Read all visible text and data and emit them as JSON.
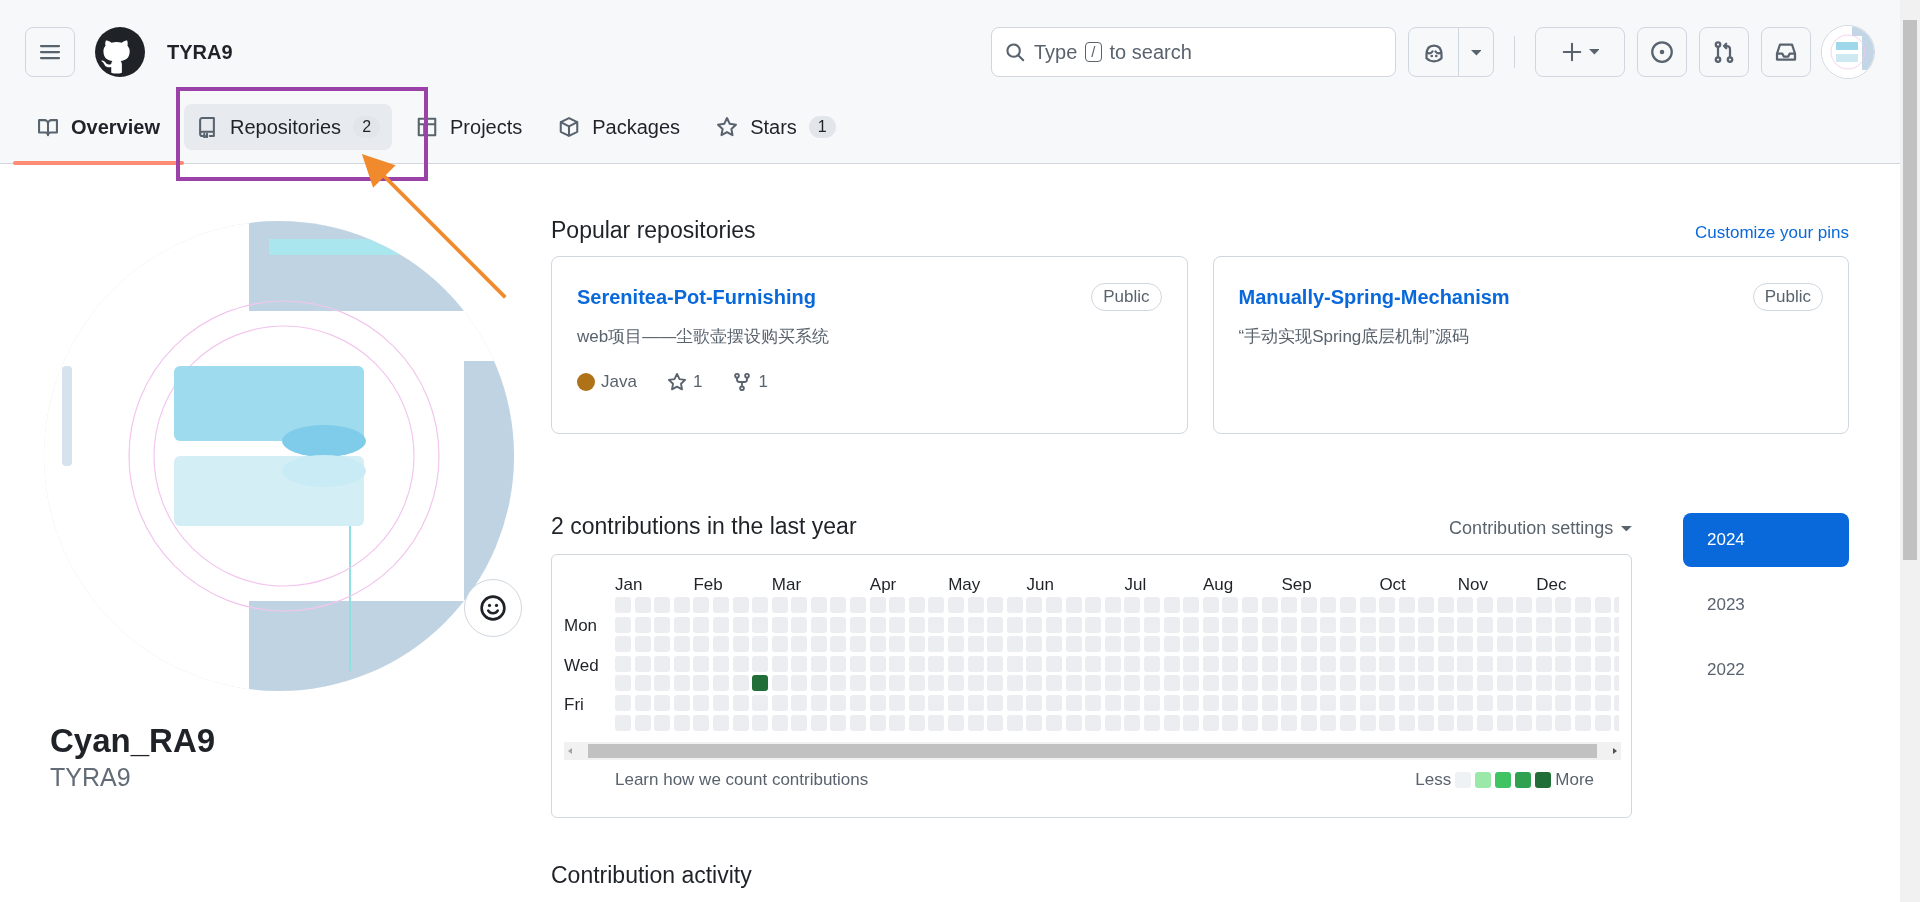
{
  "header": {
    "username": "TYRA9",
    "search": {
      "before": "Type",
      "key": "/",
      "after": "to search"
    }
  },
  "tabs": [
    {
      "label": "Overview",
      "selected": true,
      "hovered": false
    },
    {
      "label": "Repositories",
      "count": "2",
      "selected": false,
      "hovered": true
    },
    {
      "label": "Projects",
      "selected": false,
      "hovered": false
    },
    {
      "label": "Packages",
      "selected": false,
      "hovered": false
    },
    {
      "label": "Stars",
      "count": "1",
      "selected": false,
      "hovered": false
    }
  ],
  "profile": {
    "name": "Cyan_RA9",
    "login": "TYRA9"
  },
  "popular": {
    "title": "Popular repositories",
    "action": "Customize your pins",
    "repos": [
      {
        "name": "Serenitea-Pot-Furnishing",
        "visibility": "Public",
        "description": "web项目——尘歌壶摆设购买系统",
        "language": {
          "name": "Java",
          "color": "#b07219"
        },
        "stargazers": "1",
        "forks": "1"
      },
      {
        "name": "Manually-Spring-Mechanism",
        "visibility": "Public",
        "description": "“手动实现Spring底层机制”源码"
      }
    ]
  },
  "contributions": {
    "title": "2 contributions in the last year",
    "settings": "Contribution settings",
    "months": [
      "Jan",
      "Feb",
      "Mar",
      "Apr",
      "May",
      "Jun",
      "Jul",
      "Aug",
      "Sep",
      "Oct",
      "Nov",
      "Dec"
    ],
    "weekdays": [
      "Mon",
      "Wed",
      "Fri"
    ],
    "weeks": [
      [
        {
          "color": "#ebedf0"
        },
        {
          "color": "#ebedf0"
        },
        {
          "color": "#ebedf0"
        },
        {
          "color": "#ebedf0"
        },
        {
          "color": "#ebedf0"
        },
        {
          "color": "#ebedf0"
        },
        {
          "color": "#ebedf0"
        }
      ],
      [
        {
          "color": "#ebedf0"
        },
        {
          "color": "#ebedf0"
        },
        {
          "color": "#ebedf0"
        },
        {
          "color": "#ebedf0"
        },
        {
          "color": "#ebedf0"
        },
        {
          "color": "#ebedf0"
        },
        {
          "color": "#ebedf0"
        }
      ],
      [
        {
          "color": "#ebedf0"
        },
        {
          "color": "#ebedf0"
        },
        {
          "color": "#ebedf0"
        },
        {
          "color": "#ebedf0"
        },
        {
          "color": "#ebedf0"
        },
        {
          "color": "#ebedf0"
        },
        {
          "color": "#ebedf0"
        }
      ],
      [
        {
          "color": "#ebedf0"
        },
        {
          "color": "#ebedf0"
        },
        {
          "color": "#ebedf0"
        },
        {
          "color": "#ebedf0"
        },
        {
          "color": "#ebedf0"
        },
        {
          "color": "#ebedf0"
        },
        {
          "color": "#ebedf0"
        }
      ],
      [
        {
          "color": "#ebedf0"
        },
        {
          "color": "#ebedf0"
        },
        {
          "color": "#ebedf0"
        },
        {
          "color": "#ebedf0"
        },
        {
          "color": "#ebedf0"
        },
        {
          "color": "#ebedf0"
        },
        {
          "color": "#ebedf0"
        }
      ],
      [
        {
          "color": "#ebedf0"
        },
        {
          "color": "#ebedf0"
        },
        {
          "color": "#ebedf0"
        },
        {
          "color": "#ebedf0"
        },
        {
          "color": "#ebedf0"
        },
        {
          "color": "#ebedf0"
        },
        {
          "color": "#ebedf0"
        }
      ],
      [
        {
          "color": "#ebedf0"
        },
        {
          "color": "#ebedf0"
        },
        {
          "color": "#ebedf0"
        },
        {
          "color": "#ebedf0"
        },
        {
          "color": "#ebedf0"
        },
        {
          "color": "#ebedf0"
        },
        {
          "color": "#ebedf0"
        }
      ],
      [
        {
          "color": "#ebedf0"
        },
        {
          "color": "#ebedf0"
        },
        {
          "color": "#ebedf0"
        },
        {
          "color": "#ebedf0"
        },
        {
          "color": "#216e39"
        },
        {
          "color": "#ebedf0"
        },
        {
          "color": "#ebedf0"
        }
      ],
      [
        {
          "color": "#ebedf0"
        },
        {
          "color": "#ebedf0"
        },
        {
          "color": "#ebedf0"
        },
        {
          "color": "#ebedf0"
        },
        {
          "color": "#ebedf0"
        },
        {
          "color": "#ebedf0"
        },
        {
          "color": "#ebedf0"
        }
      ],
      [
        {
          "color": "#ebedf0"
        },
        {
          "color": "#ebedf0"
        },
        {
          "color": "#ebedf0"
        },
        {
          "color": "#ebedf0"
        },
        {
          "color": "#ebedf0"
        },
        {
          "color": "#ebedf0"
        },
        {
          "color": "#ebedf0"
        }
      ],
      [
        {
          "color": "#ebedf0"
        },
        {
          "color": "#ebedf0"
        },
        {
          "color": "#ebedf0"
        },
        {
          "color": "#ebedf0"
        },
        {
          "color": "#ebedf0"
        },
        {
          "color": "#ebedf0"
        },
        {
          "color": "#ebedf0"
        }
      ],
      [
        {
          "color": "#ebedf0"
        },
        {
          "color": "#ebedf0"
        },
        {
          "color": "#ebedf0"
        },
        {
          "color": "#ebedf0"
        },
        {
          "color": "#ebedf0"
        },
        {
          "color": "#ebedf0"
        },
        {
          "color": "#ebedf0"
        }
      ],
      [
        {
          "color": "#ebedf0"
        },
        {
          "color": "#ebedf0"
        },
        {
          "color": "#ebedf0"
        },
        {
          "color": "#ebedf0"
        },
        {
          "color": "#ebedf0"
        },
        {
          "color": "#ebedf0"
        },
        {
          "color": "#ebedf0"
        }
      ],
      [
        {
          "color": "#ebedf0"
        },
        {
          "color": "#ebedf0"
        },
        {
          "color": "#ebedf0"
        },
        {
          "color": "#ebedf0"
        },
        {
          "color": "#ebedf0"
        },
        {
          "color": "#ebedf0"
        },
        {
          "color": "#ebedf0"
        }
      ],
      [
        {
          "color": "#ebedf0"
        },
        {
          "color": "#ebedf0"
        },
        {
          "color": "#ebedf0"
        },
        {
          "color": "#ebedf0"
        },
        {
          "color": "#ebedf0"
        },
        {
          "color": "#ebedf0"
        },
        {
          "color": "#ebedf0"
        }
      ],
      [
        {
          "color": "#ebedf0"
        },
        {
          "color": "#ebedf0"
        },
        {
          "color": "#ebedf0"
        },
        {
          "color": "#ebedf0"
        },
        {
          "color": "#ebedf0"
        },
        {
          "color": "#ebedf0"
        },
        {
          "color": "#ebedf0"
        }
      ],
      [
        {
          "color": "#ebedf0"
        },
        {
          "color": "#ebedf0"
        },
        {
          "color": "#ebedf0"
        },
        {
          "color": "#ebedf0"
        },
        {
          "color": "#ebedf0"
        },
        {
          "color": "#ebedf0"
        },
        {
          "color": "#ebedf0"
        }
      ],
      [
        {
          "color": "#ebedf0"
        },
        {
          "color": "#ebedf0"
        },
        {
          "color": "#ebedf0"
        },
        {
          "color": "#ebedf0"
        },
        {
          "color": "#ebedf0"
        },
        {
          "color": "#ebedf0"
        },
        {
          "color": "#ebedf0"
        }
      ],
      [
        {
          "color": "#ebedf0"
        },
        {
          "color": "#ebedf0"
        },
        {
          "color": "#ebedf0"
        },
        {
          "color": "#ebedf0"
        },
        {
          "color": "#ebedf0"
        },
        {
          "color": "#ebedf0"
        },
        {
          "color": "#ebedf0"
        }
      ],
      [
        {
          "color": "#ebedf0"
        },
        {
          "color": "#ebedf0"
        },
        {
          "color": "#ebedf0"
        },
        {
          "color": "#ebedf0"
        },
        {
          "color": "#ebedf0"
        },
        {
          "color": "#ebedf0"
        },
        {
          "color": "#ebedf0"
        }
      ],
      [
        {
          "color": "#ebedf0"
        },
        {
          "color": "#ebedf0"
        },
        {
          "color": "#ebedf0"
        },
        {
          "color": "#ebedf0"
        },
        {
          "color": "#ebedf0"
        },
        {
          "color": "#ebedf0"
        },
        {
          "color": "#ebedf0"
        }
      ],
      [
        {
          "color": "#ebedf0"
        },
        {
          "color": "#ebedf0"
        },
        {
          "color": "#ebedf0"
        },
        {
          "color": "#ebedf0"
        },
        {
          "color": "#ebedf0"
        },
        {
          "color": "#ebedf0"
        },
        {
          "color": "#ebedf0"
        }
      ],
      [
        {
          "color": "#ebedf0"
        },
        {
          "color": "#ebedf0"
        },
        {
          "color": "#ebedf0"
        },
        {
          "color": "#ebedf0"
        },
        {
          "color": "#ebedf0"
        },
        {
          "color": "#ebedf0"
        },
        {
          "color": "#ebedf0"
        }
      ],
      [
        {
          "color": "#ebedf0"
        },
        {
          "color": "#ebedf0"
        },
        {
          "color": "#ebedf0"
        },
        {
          "color": "#ebedf0"
        },
        {
          "color": "#ebedf0"
        },
        {
          "color": "#ebedf0"
        },
        {
          "color": "#ebedf0"
        }
      ],
      [
        {
          "color": "#ebedf0"
        },
        {
          "color": "#ebedf0"
        },
        {
          "color": "#ebedf0"
        },
        {
          "color": "#ebedf0"
        },
        {
          "color": "#ebedf0"
        },
        {
          "color": "#ebedf0"
        },
        {
          "color": "#ebedf0"
        }
      ],
      [
        {
          "color": "#ebedf0"
        },
        {
          "color": "#ebedf0"
        },
        {
          "color": "#ebedf0"
        },
        {
          "color": "#ebedf0"
        },
        {
          "color": "#ebedf0"
        },
        {
          "color": "#ebedf0"
        },
        {
          "color": "#ebedf0"
        }
      ],
      [
        {
          "color": "#ebedf0"
        },
        {
          "color": "#ebedf0"
        },
        {
          "color": "#ebedf0"
        },
        {
          "color": "#ebedf0"
        },
        {
          "color": "#ebedf0"
        },
        {
          "color": "#ebedf0"
        },
        {
          "color": "#ebedf0"
        }
      ],
      [
        {
          "color": "#ebedf0"
        },
        {
          "color": "#ebedf0"
        },
        {
          "color": "#ebedf0"
        },
        {
          "color": "#ebedf0"
        },
        {
          "color": "#ebedf0"
        },
        {
          "color": "#ebedf0"
        },
        {
          "color": "#ebedf0"
        }
      ],
      [
        {
          "color": "#ebedf0"
        },
        {
          "color": "#ebedf0"
        },
        {
          "color": "#ebedf0"
        },
        {
          "color": "#ebedf0"
        },
        {
          "color": "#ebedf0"
        },
        {
          "color": "#ebedf0"
        },
        {
          "color": "#ebedf0"
        }
      ],
      [
        {
          "color": "#ebedf0"
        },
        {
          "color": "#ebedf0"
        },
        {
          "color": "#ebedf0"
        },
        {
          "color": "#ebedf0"
        },
        {
          "color": "#ebedf0"
        },
        {
          "color": "#ebedf0"
        },
        {
          "color": "#ebedf0"
        }
      ],
      [
        {
          "color": "#ebedf0"
        },
        {
          "color": "#ebedf0"
        },
        {
          "color": "#ebedf0"
        },
        {
          "color": "#ebedf0"
        },
        {
          "color": "#ebedf0"
        },
        {
          "color": "#ebedf0"
        },
        {
          "color": "#ebedf0"
        }
      ],
      [
        {
          "color": "#ebedf0"
        },
        {
          "color": "#ebedf0"
        },
        {
          "color": "#ebedf0"
        },
        {
          "color": "#ebedf0"
        },
        {
          "color": "#ebedf0"
        },
        {
          "color": "#ebedf0"
        },
        {
          "color": "#ebedf0"
        }
      ],
      [
        {
          "color": "#ebedf0"
        },
        {
          "color": "#ebedf0"
        },
        {
          "color": "#ebedf0"
        },
        {
          "color": "#ebedf0"
        },
        {
          "color": "#ebedf0"
        },
        {
          "color": "#ebedf0"
        },
        {
          "color": "#ebedf0"
        }
      ],
      [
        {
          "color": "#ebedf0"
        },
        {
          "color": "#ebedf0"
        },
        {
          "color": "#ebedf0"
        },
        {
          "color": "#ebedf0"
        },
        {
          "color": "#ebedf0"
        },
        {
          "color": "#ebedf0"
        },
        {
          "color": "#ebedf0"
        }
      ],
      [
        {
          "color": "#ebedf0"
        },
        {
          "color": "#ebedf0"
        },
        {
          "color": "#ebedf0"
        },
        {
          "color": "#ebedf0"
        },
        {
          "color": "#ebedf0"
        },
        {
          "color": "#ebedf0"
        },
        {
          "color": "#ebedf0"
        }
      ],
      [
        {
          "color": "#ebedf0"
        },
        {
          "color": "#ebedf0"
        },
        {
          "color": "#ebedf0"
        },
        {
          "color": "#ebedf0"
        },
        {
          "color": "#ebedf0"
        },
        {
          "color": "#ebedf0"
        },
        {
          "color": "#ebedf0"
        }
      ],
      [
        {
          "color": "#ebedf0"
        },
        {
          "color": "#ebedf0"
        },
        {
          "color": "#ebedf0"
        },
        {
          "color": "#ebedf0"
        },
        {
          "color": "#ebedf0"
        },
        {
          "color": "#ebedf0"
        },
        {
          "color": "#ebedf0"
        }
      ],
      [
        {
          "color": "#ebedf0"
        },
        {
          "color": "#ebedf0"
        },
        {
          "color": "#ebedf0"
        },
        {
          "color": "#ebedf0"
        },
        {
          "color": "#ebedf0"
        },
        {
          "color": "#ebedf0"
        },
        {
          "color": "#ebedf0"
        }
      ],
      [
        {
          "color": "#ebedf0"
        },
        {
          "color": "#ebedf0"
        },
        {
          "color": "#ebedf0"
        },
        {
          "color": "#ebedf0"
        },
        {
          "color": "#ebedf0"
        },
        {
          "color": "#ebedf0"
        },
        {
          "color": "#ebedf0"
        }
      ],
      [
        {
          "color": "#ebedf0"
        },
        {
          "color": "#ebedf0"
        },
        {
          "color": "#ebedf0"
        },
        {
          "color": "#ebedf0"
        },
        {
          "color": "#ebedf0"
        },
        {
          "color": "#ebedf0"
        },
        {
          "color": "#ebedf0"
        }
      ],
      [
        {
          "color": "#ebedf0"
        },
        {
          "color": "#ebedf0"
        },
        {
          "color": "#ebedf0"
        },
        {
          "color": "#ebedf0"
        },
        {
          "color": "#ebedf0"
        },
        {
          "color": "#ebedf0"
        },
        {
          "color": "#ebedf0"
        }
      ],
      [
        {
          "color": "#ebedf0"
        },
        {
          "color": "#ebedf0"
        },
        {
          "color": "#ebedf0"
        },
        {
          "color": "#ebedf0"
        },
        {
          "color": "#ebedf0"
        },
        {
          "color": "#ebedf0"
        },
        {
          "color": "#ebedf0"
        }
      ],
      [
        {
          "color": "#ebedf0"
        },
        {
          "color": "#ebedf0"
        },
        {
          "color": "#ebedf0"
        },
        {
          "color": "#ebedf0"
        },
        {
          "color": "#ebedf0"
        },
        {
          "color": "#ebedf0"
        },
        {
          "color": "#ebedf0"
        }
      ],
      [
        {
          "color": "#ebedf0"
        },
        {
          "color": "#ebedf0"
        },
        {
          "color": "#ebedf0"
        },
        {
          "color": "#ebedf0"
        },
        {
          "color": "#ebedf0"
        },
        {
          "color": "#ebedf0"
        },
        {
          "color": "#ebedf0"
        }
      ],
      [
        {
          "color": "#ebedf0"
        },
        {
          "color": "#ebedf0"
        },
        {
          "color": "#ebedf0"
        },
        {
          "color": "#ebedf0"
        },
        {
          "color": "#ebedf0"
        },
        {
          "color": "#ebedf0"
        },
        {
          "color": "#ebedf0"
        }
      ],
      [
        {
          "color": "#ebedf0"
        },
        {
          "color": "#ebedf0"
        },
        {
          "color": "#ebedf0"
        },
        {
          "color": "#ebedf0"
        },
        {
          "color": "#ebedf0"
        },
        {
          "color": "#ebedf0"
        },
        {
          "color": "#ebedf0"
        }
      ],
      [
        {
          "color": "#ebedf0"
        },
        {
          "color": "#ebedf0"
        },
        {
          "color": "#ebedf0"
        },
        {
          "color": "#ebedf0"
        },
        {
          "color": "#ebedf0"
        },
        {
          "color": "#ebedf0"
        },
        {
          "color": "#ebedf0"
        }
      ],
      [
        {
          "color": "#ebedf0"
        },
        {
          "color": "#ebedf0"
        },
        {
          "color": "#ebedf0"
        },
        {
          "color": "#ebedf0"
        },
        {
          "color": "#ebedf0"
        },
        {
          "color": "#ebedf0"
        },
        {
          "color": "#ebedf0"
        }
      ],
      [
        {
          "color": "#ebedf0"
        },
        {
          "color": "#ebedf0"
        },
        {
          "color": "#ebedf0"
        },
        {
          "color": "#ebedf0"
        },
        {
          "color": "#ebedf0"
        },
        {
          "color": "#ebedf0"
        },
        {
          "color": "#ebedf0"
        }
      ],
      [
        {
          "color": "#ebedf0"
        },
        {
          "color": "#ebedf0"
        },
        {
          "color": "#ebedf0"
        },
        {
          "color": "#ebedf0"
        },
        {
          "color": "#ebedf0"
        },
        {
          "color": "#ebedf0"
        },
        {
          "color": "#ebedf0"
        }
      ],
      [
        {
          "color": "#ebedf0"
        },
        {
          "color": "#ebedf0"
        },
        {
          "color": "#ebedf0"
        },
        {
          "color": "#ebedf0"
        },
        {
          "color": "#ebedf0"
        },
        {
          "color": "#ebedf0"
        },
        {
          "color": "#ebedf0"
        }
      ],
      [
        {
          "color": "#ebedf0"
        },
        {
          "color": "#ebedf0"
        },
        {
          "color": "#ebedf0"
        },
        {
          "color": "#ebedf0"
        },
        {
          "color": "#ebedf0"
        },
        {
          "color": "#ebedf0"
        },
        {
          "color": "#ebedf0"
        }
      ]
    ],
    "footer_link": "Learn how we count contributions",
    "legend_less": "Less",
    "legend_more": "More"
  },
  "years": [
    {
      "label": "2024",
      "selected": true
    },
    {
      "label": "2023",
      "selected": false
    },
    {
      "label": "2022",
      "selected": false
    }
  ],
  "activity_title": "Contribution activity"
}
